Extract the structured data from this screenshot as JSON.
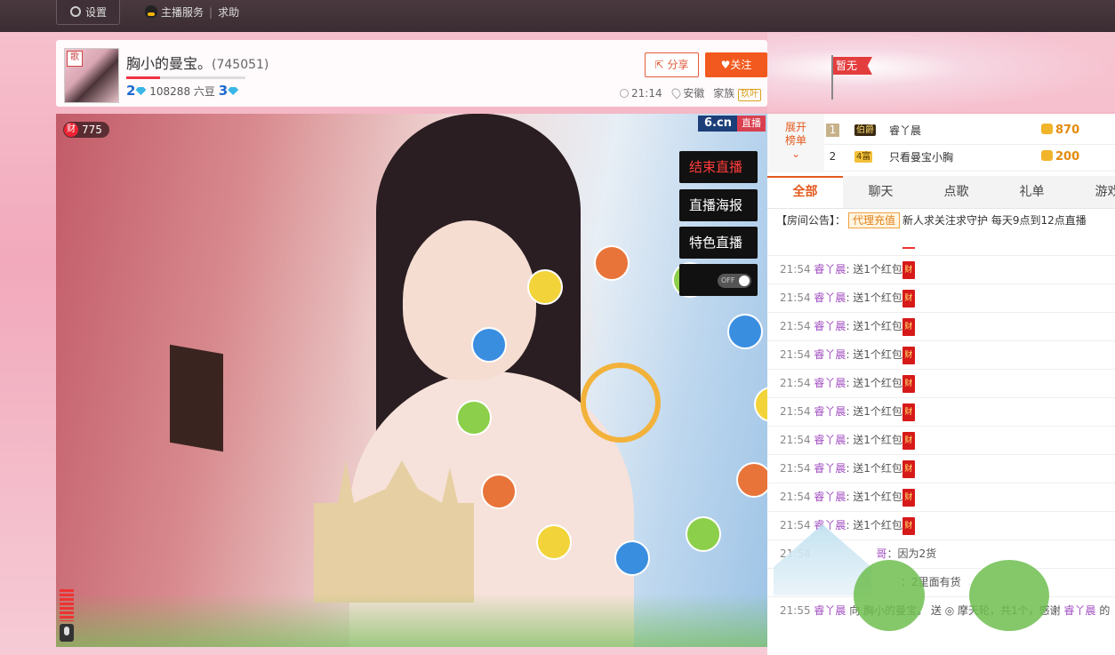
{
  "topbar": {
    "settings_label": "设置",
    "anchor_service": "主播服务",
    "help": "求助"
  },
  "host": {
    "name": "胸小的曼宝。",
    "id": "(745051)",
    "avatar_badge": "歌",
    "level_left": "2",
    "beans": "108288 六豆",
    "level_right": "3",
    "level_progress": 0.28,
    "share_label": "分享",
    "follow_label": "关注",
    "time": "21:14",
    "location": "安徽",
    "family_label": "家族",
    "family_tag": "玖叶"
  },
  "crown": {
    "flag_text": "暂无"
  },
  "video": {
    "wealth_icon": "财",
    "wealth_count": "775",
    "logo": "6.cn",
    "live_tag": "直播",
    "buttons": [
      "结束直播",
      "直播海报",
      "特色直播"
    ],
    "toggle_label": "OFF"
  },
  "ranking": {
    "expand_line1": "展开",
    "expand_line2": "榜单",
    "rows": [
      {
        "rank": "1",
        "tag": "伯爵",
        "name": "睿丫晨",
        "score": "870"
      },
      {
        "rank": "2",
        "tag": "4富",
        "name": "只看曼宝小胸",
        "score": "200"
      }
    ]
  },
  "tabs": [
    "全部",
    "聊天",
    "点歌",
    "礼单",
    "游戏"
  ],
  "notice": {
    "prefix": "【房间公告】：",
    "agent": "代理充值",
    "text": "新人求关注求守护 每天9点到12点直播"
  },
  "chat": {
    "gift_msgs": [
      {
        "time": "21:54",
        "user": "睿丫晨",
        "text": ": 送1个红包",
        "icon": "财"
      },
      {
        "time": "21:54",
        "user": "睿丫晨",
        "text": ": 送1个红包",
        "icon": "财"
      },
      {
        "time": "21:54",
        "user": "睿丫晨",
        "text": ": 送1个红包",
        "icon": "财"
      },
      {
        "time": "21:54",
        "user": "睿丫晨",
        "text": ": 送1个红包",
        "icon": "财"
      },
      {
        "time": "21:54",
        "user": "睿丫晨",
        "text": ": 送1个红包",
        "icon": "财"
      },
      {
        "time": "21:54",
        "user": "睿丫晨",
        "text": ": 送1个红包",
        "icon": "财"
      },
      {
        "time": "21:54",
        "user": "睿丫晨",
        "text": ": 送1个红包",
        "icon": "财"
      },
      {
        "time": "21:54",
        "user": "睿丫晨",
        "text": ": 送1个红包",
        "icon": "财"
      },
      {
        "time": "21:54",
        "user": "睿丫晨",
        "text": ": 送1个红包",
        "icon": "财"
      },
      {
        "time": "21:54",
        "user": "睿丫晨",
        "text": ": 送1个红包",
        "icon": "财"
      }
    ],
    "msg_a": {
      "time": "21:54",
      "user": "哥",
      "text": "：因为2货"
    },
    "msg_b": {
      "text": "：2里面有货"
    },
    "msg_c": {
      "time": "21:55",
      "user": "睿丫晨",
      "text1": "向 胸小的曼宝。 送",
      "text2": "摩天轮，共1个，感谢",
      "user2": "睿丫晨",
      "text3": "的"
    }
  }
}
